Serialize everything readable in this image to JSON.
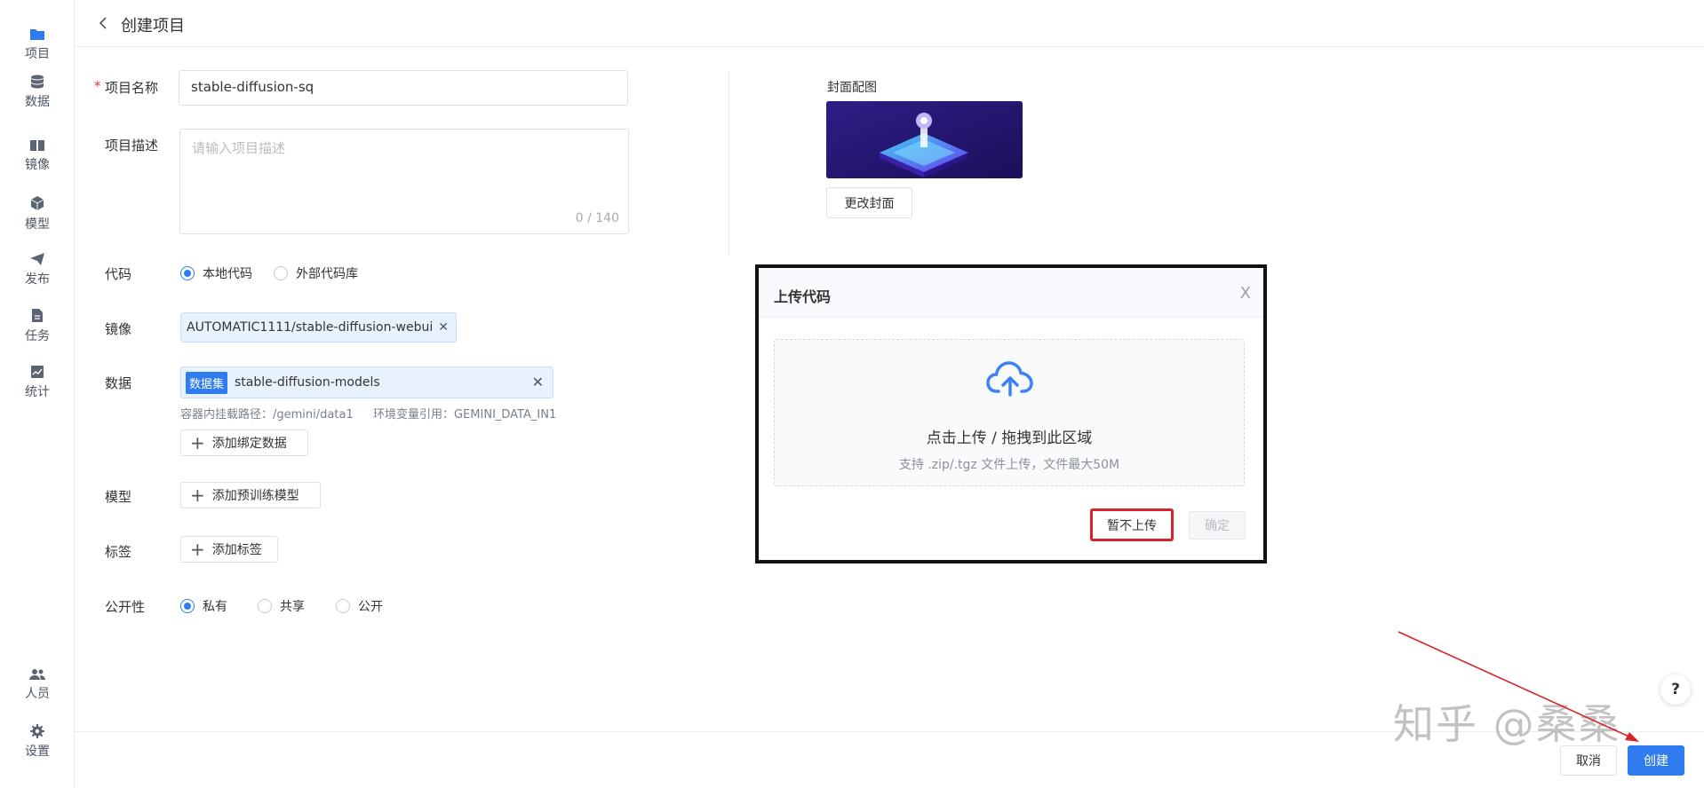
{
  "sidebar": {
    "items": [
      {
        "label": "项目",
        "icon": "folder-icon"
      },
      {
        "label": "数据",
        "icon": "database-icon"
      },
      {
        "label": "镜像",
        "icon": "image-icon"
      },
      {
        "label": "模型",
        "icon": "cube-icon"
      },
      {
        "label": "发布",
        "icon": "send-icon"
      },
      {
        "label": "任务",
        "icon": "document-icon"
      },
      {
        "label": "统计",
        "icon": "chart-icon"
      }
    ],
    "bottom": [
      {
        "label": "人员",
        "icon": "people-icon"
      },
      {
        "label": "设置",
        "icon": "gear-icon"
      }
    ]
  },
  "header": {
    "title": "创建项目"
  },
  "form": {
    "name_label": "项目名称",
    "name_value": "stable-diffusion-sq",
    "desc_label": "项目描述",
    "desc_placeholder": "请输入项目描述",
    "desc_count": "0 / 140",
    "code_label": "代码",
    "code_options": [
      "本地代码",
      "外部代码库"
    ],
    "image_label": "镜像",
    "image_tag": "AUTOMATIC1111/stable-diffusion-webui",
    "data_label": "数据",
    "data_badge": "数据集",
    "data_tag": "stable-diffusion-models",
    "data_note_path": "容器内挂载路径：/gemini/data1",
    "data_note_env": "环境变量引用：GEMINI_DATA_IN1",
    "add_data": "添加绑定数据",
    "model_label": "模型",
    "add_model": "添加预训练模型",
    "tag_label": "标签",
    "add_tag": "添加标签",
    "visibility_label": "公开性",
    "visibility_options": [
      "私有",
      "共享",
      "公开"
    ]
  },
  "cover": {
    "label": "封面配图",
    "change_button": "更改封面"
  },
  "modal": {
    "title": "上传代码",
    "close": "X",
    "drop_main": "点击上传 / 拖拽到此区域",
    "drop_sub": "支持 .zip/.tgz 文件上传，文件最大50M",
    "skip_button": "暂不上传",
    "ok_button": "确定"
  },
  "footer": {
    "cancel": "取消",
    "create": "创建"
  },
  "help": "?",
  "watermark": "知乎 @桑桑",
  "colors": {
    "primary": "#2f7cf0",
    "highlight_box": "#d9232a",
    "annotation_arrow": "#d9232a"
  }
}
